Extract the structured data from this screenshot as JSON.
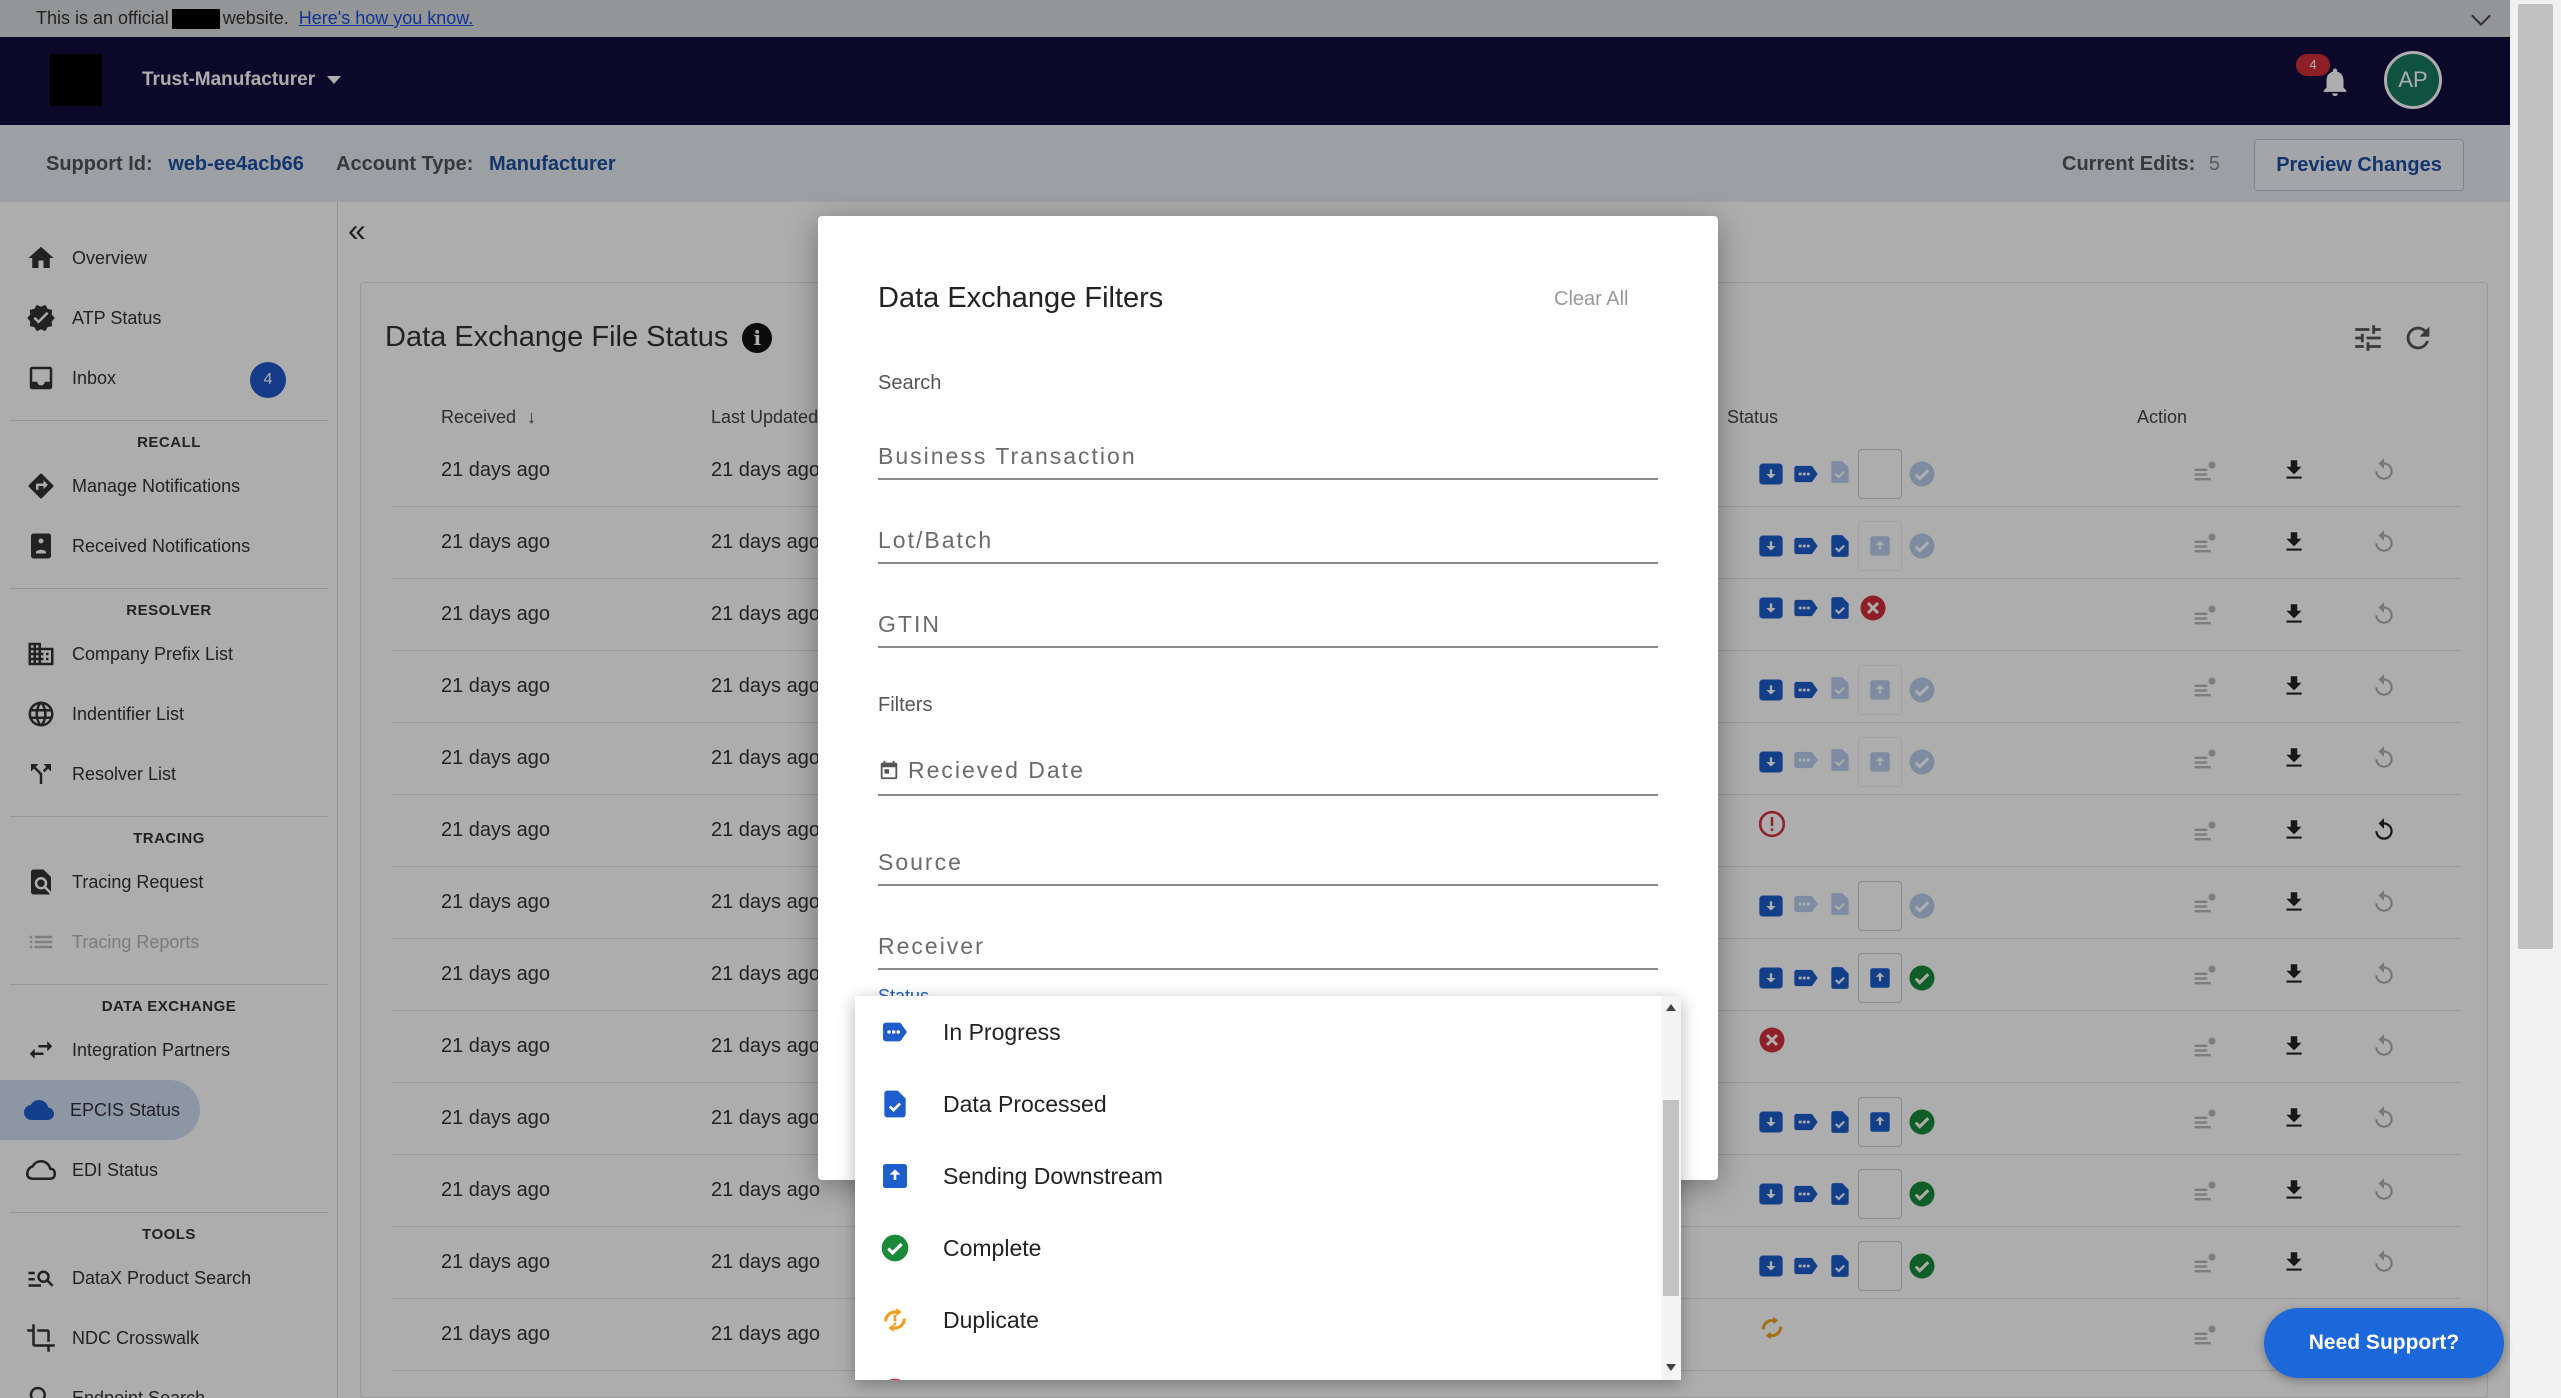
{
  "banner": {
    "text": "This is an official",
    "text_after": "website.",
    "link": "Here's how you know."
  },
  "header": {
    "org_name": "Trust-Manufacturer",
    "notification_count": "4",
    "avatar_initials": "AP"
  },
  "subheader": {
    "support_id_label": "Support Id:",
    "support_id_value": "web-ee4acb66",
    "account_type_label": "Account Type:",
    "account_type_value": "Manufacturer",
    "current_edits_label": "Current Edits:",
    "current_edits_value": "5",
    "preview_button": "Preview Changes"
  },
  "sidebar": {
    "overview": "Overview",
    "atp_status": "ATP Status",
    "inbox": "Inbox",
    "inbox_count": "4",
    "recall_title": "RECALL",
    "manage_notifications": "Manage Notifications",
    "received_notifications": "Received Notifications",
    "resolver_title": "RESOLVER",
    "company_prefix_list": "Company Prefix List",
    "identifier_list": "Indentifier List",
    "resolver_list": "Resolver List",
    "tracing_title": "TRACING",
    "tracing_request": "Tracing Request",
    "tracing_reports": "Tracing Reports",
    "data_exchange_title": "DATA EXCHANGE",
    "integration_partners": "Integration Partners",
    "epcis_status": "EPCIS Status",
    "edi_status": "EDI Status",
    "tools_title": "TOOLS",
    "datax_product_search": "DataX Product Search",
    "ndc_crosswalk": "NDC Crosswalk",
    "endpoint_search": "Endpoint Search"
  },
  "main": {
    "title": "Data Exchange File Status",
    "columns": {
      "received": "Received",
      "last_updated": "Last Updated",
      "status": "Status",
      "action": "Action"
    },
    "rows": [
      {
        "received": "21 days ago",
        "last_updated": "21 days ago"
      },
      {
        "received": "21 days ago",
        "last_updated": "21 days ago"
      },
      {
        "received": "21 days ago",
        "last_updated": "21 days ago"
      },
      {
        "received": "21 days ago",
        "last_updated": "21 days ago"
      },
      {
        "received": "21 days ago",
        "last_updated": "21 days ago"
      },
      {
        "received": "21 days ago",
        "last_updated": "21 days ago"
      },
      {
        "received": "21 days ago",
        "last_updated": "21 days ago"
      },
      {
        "received": "21 days ago",
        "last_updated": "21 days ago"
      },
      {
        "received": "21 days ago",
        "last_updated": "21 days ago"
      },
      {
        "received": "21 days ago",
        "last_updated": "21 days ago"
      },
      {
        "received": "21 days ago",
        "last_updated": "21 days ago"
      },
      {
        "received": "21 days ago",
        "last_updated": "21 days ago"
      },
      {
        "received": "21 days ago",
        "last_updated": "21 days ago"
      }
    ]
  },
  "modal": {
    "title": "Data Exchange Filters",
    "clear_all": "Clear All",
    "search_label": "Search",
    "business_transaction_placeholder": "Business Transaction",
    "lot_batch_placeholder": "Lot/Batch",
    "gtin_placeholder": "GTIN",
    "filters_label": "Filters",
    "received_date_placeholder": "Recieved Date",
    "source_placeholder": "Source",
    "receiver_placeholder": "Receiver",
    "status_label": "Status",
    "status_options": [
      "In Progress",
      "Data Processed",
      "Sending Downstream",
      "Complete",
      "Duplicate"
    ]
  },
  "support_button": "Need Support?",
  "colors": {
    "header_bg": "#130c3e",
    "primary_blue": "#1c67da",
    "success_green": "#1a8a3a",
    "error_red": "#d32f3a",
    "warning_orange": "#f0a020"
  }
}
